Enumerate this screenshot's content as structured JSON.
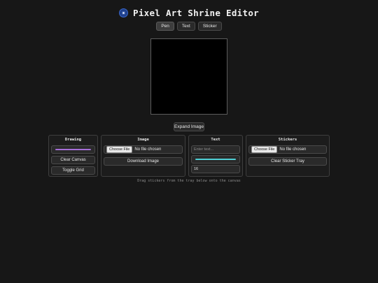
{
  "app": {
    "title": "Pixel Art Shrine Editor",
    "icon": "eye-charm-icon"
  },
  "modes": [
    {
      "label": "Pen",
      "active": true
    },
    {
      "label": "Text",
      "active": false
    },
    {
      "label": "Sticker",
      "active": false
    }
  ],
  "canvas": {
    "background": "#000000"
  },
  "expand_label": "Expand Image",
  "panels": {
    "drawing": {
      "title": "Drawing",
      "color_value": "#a66fd8",
      "clear_label": "Clear Canvas",
      "grid_label": "Toggle Grid"
    },
    "image": {
      "title": "Image",
      "choose_label": "Choose File",
      "no_file": "No file chosen",
      "download_label": "Download Image"
    },
    "text": {
      "title": "Text",
      "placeholder": "Enter text...",
      "color_value": "#4fd0d6",
      "size_value": "16"
    },
    "stickers": {
      "title": "Stickers",
      "choose_label": "Choose File",
      "no_file": "No file chosen",
      "clear_label": "Clear Sticker Tray"
    }
  },
  "hint": "Drag stickers from the tray below onto the canvas"
}
